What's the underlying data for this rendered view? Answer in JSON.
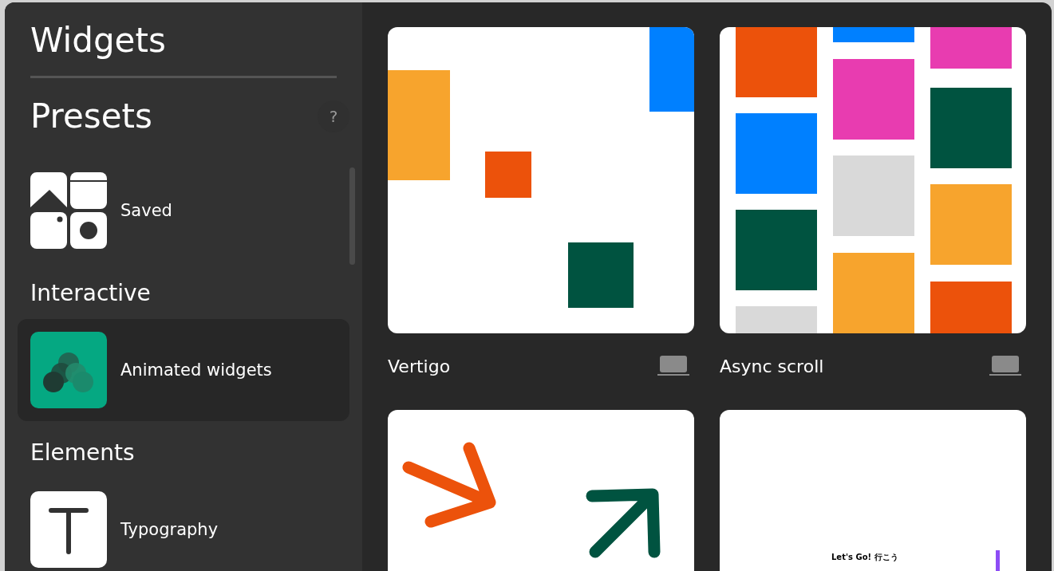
{
  "sidebar": {
    "title": "Widgets",
    "sections": [
      {
        "heading": "Presets",
        "help": "?",
        "items": [
          {
            "label": "Saved",
            "kind": "saved",
            "selected": false
          }
        ]
      },
      {
        "heading": "Interactive",
        "items": [
          {
            "label": "Animated widgets",
            "kind": "animated",
            "selected": true
          }
        ]
      },
      {
        "heading": "Elements",
        "items": [
          {
            "label": "Typography",
            "kind": "typography",
            "selected": false
          }
        ]
      }
    ]
  },
  "cards": [
    {
      "title": "Vertigo",
      "kind": "vertigo"
    },
    {
      "title": "Async scroll",
      "kind": "async"
    },
    {
      "kind": "arrows"
    },
    {
      "kind": "text",
      "preview_text": "Let's Go! 行こう"
    }
  ]
}
